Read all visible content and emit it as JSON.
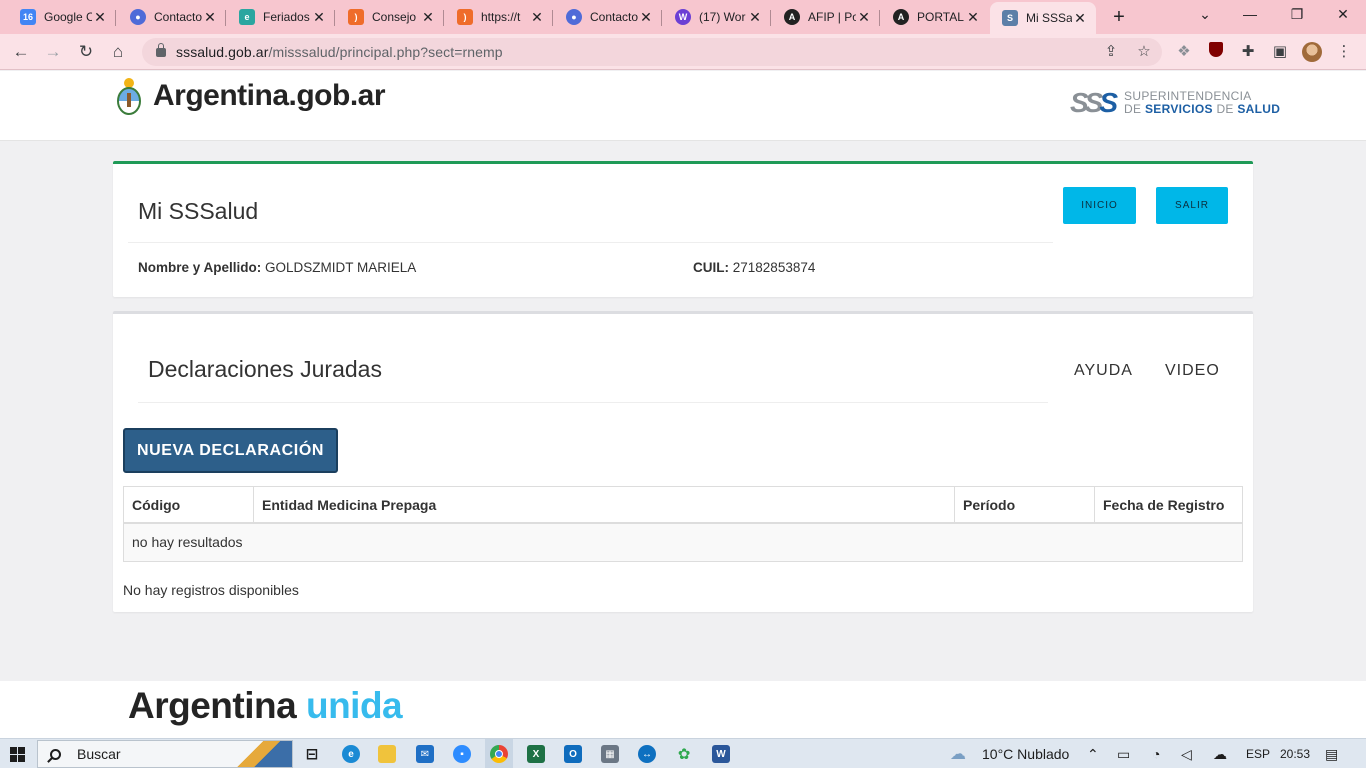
{
  "browser": {
    "tabs": [
      {
        "title": "Google C",
        "favicon": "calendar-icon",
        "color": "#4285f4",
        "glyph": "16"
      },
      {
        "title": "Contacto",
        "favicon": "contacts-icon",
        "color": "#4f6bd8",
        "glyph": "●"
      },
      {
        "title": "Feriados",
        "favicon": "e-icon",
        "color": "#2aa6a0",
        "glyph": "e"
      },
      {
        "title": "Consejo",
        "favicon": "rss-icon",
        "color": "#ef6c2a",
        "glyph": ")"
      },
      {
        "title": "https://t",
        "favicon": "rss-icon",
        "color": "#ef6c2a",
        "glyph": ")"
      },
      {
        "title": "Contacto",
        "favicon": "contacts-icon",
        "color": "#4f6bd8",
        "glyph": "●"
      },
      {
        "title": "(17) Wor",
        "favicon": "w-icon",
        "color": "#6b3fd4",
        "glyph": "W"
      },
      {
        "title": "AFIP | Po",
        "favicon": "afip-icon",
        "color": "#222222",
        "glyph": "A"
      },
      {
        "title": "PORTAL",
        "favicon": "afip-icon",
        "color": "#222222",
        "glyph": "A"
      },
      {
        "title": "Mi SSSa",
        "favicon": "sss-icon",
        "color": "#5c7fa8",
        "glyph": "S"
      }
    ],
    "new_tab": "+",
    "url_host": "sssalud.gob.ar",
    "url_path": "/misssalud/principal.php?sect=rnemp"
  },
  "header": {
    "gov_logo_text": "Argentina.gob.ar",
    "sss_mark_gray": "SS",
    "sss_mark_blue": "S",
    "sss_line1": "SUPERINTENDENCIA",
    "sss_line2_a": "DE",
    "sss_line2_b": "SERVICIOS",
    "sss_line2_c": "DE",
    "sss_line2_d": "SALUD"
  },
  "user_card": {
    "title": "Mi SSSalud",
    "inicio_label": "INICIO",
    "salir_label": "SALIR",
    "name_label": "Nombre y Apellido:",
    "name_value": "GOLDSZMIDT MARIELA",
    "cuil_label": "CUIL:",
    "cuil_value": "27182853874"
  },
  "ddjj": {
    "title": "Declaraciones Juradas",
    "ayuda_label": "AYUDA",
    "video_label": "VIDEO",
    "new_button": "NUEVA DECLARACIÓN",
    "columns": [
      "Código",
      "Entidad Medicina Prepaga",
      "Período",
      "Fecha de Registro"
    ],
    "empty_row": "no hay resultados",
    "footer_note": "No hay registros disponibles"
  },
  "footer": {
    "brand_a": "Argentina",
    "brand_b": "unida"
  },
  "taskbar": {
    "search_label": "Buscar",
    "weather": "10°C  Nublado",
    "language": "ESP",
    "clock": "20:53"
  },
  "colors": {
    "accent_green": "#1f9a57",
    "cyan_button": "#00b7e8",
    "primary_button": "#2d5f8a",
    "brand_light_blue": "#37bbed",
    "sss_blue": "#1d5fa4"
  }
}
